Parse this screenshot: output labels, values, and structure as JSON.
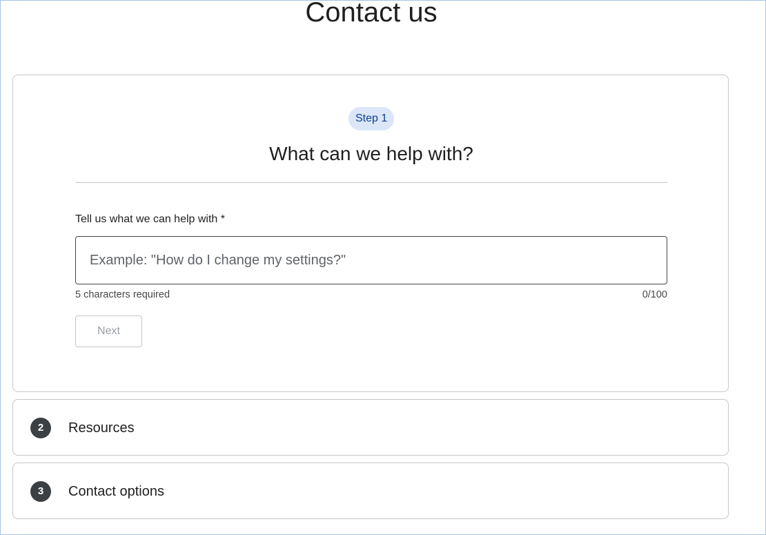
{
  "page": {
    "title": "Contact us"
  },
  "step1": {
    "chip": "Step 1",
    "heading": "What can we help with?",
    "field_label": "Tell us what we can help with *",
    "input_placeholder": "Example: \"How do I change my settings?\"",
    "input_value": "",
    "helper": "5 characters required",
    "counter": "0/100",
    "next_label": "Next"
  },
  "steps": [
    {
      "number": "2",
      "title": "Resources"
    },
    {
      "number": "3",
      "title": "Contact options"
    }
  ],
  "colors": {
    "chip_bg": "#dbe6f8",
    "chip_text": "#0b3f8f",
    "step_badge": "#3c4043",
    "border": "#c4c7c5"
  }
}
